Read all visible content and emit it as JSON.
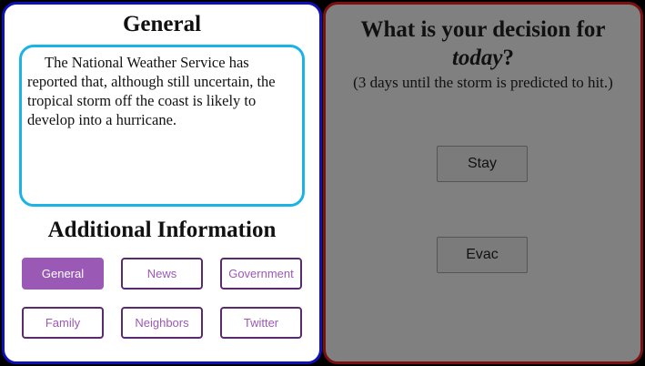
{
  "general": {
    "title": "General",
    "message": "The National Weather Service has reported that, although still uncertain, the tropical storm off the coast is likely to develop into a hurricane."
  },
  "additional": {
    "title": "Additional Information",
    "sources": [
      "General",
      "News",
      "Government",
      "Family",
      "Neighbors",
      "Twitter"
    ],
    "active": "General"
  },
  "decision": {
    "question_prefix": "What is your decision for",
    "question_emph": "today",
    "question_suffix": "?",
    "subtitle": "(3 days until the storm is predicted to hit.)",
    "stay_label": "Stay",
    "evac_label": "Evac"
  }
}
